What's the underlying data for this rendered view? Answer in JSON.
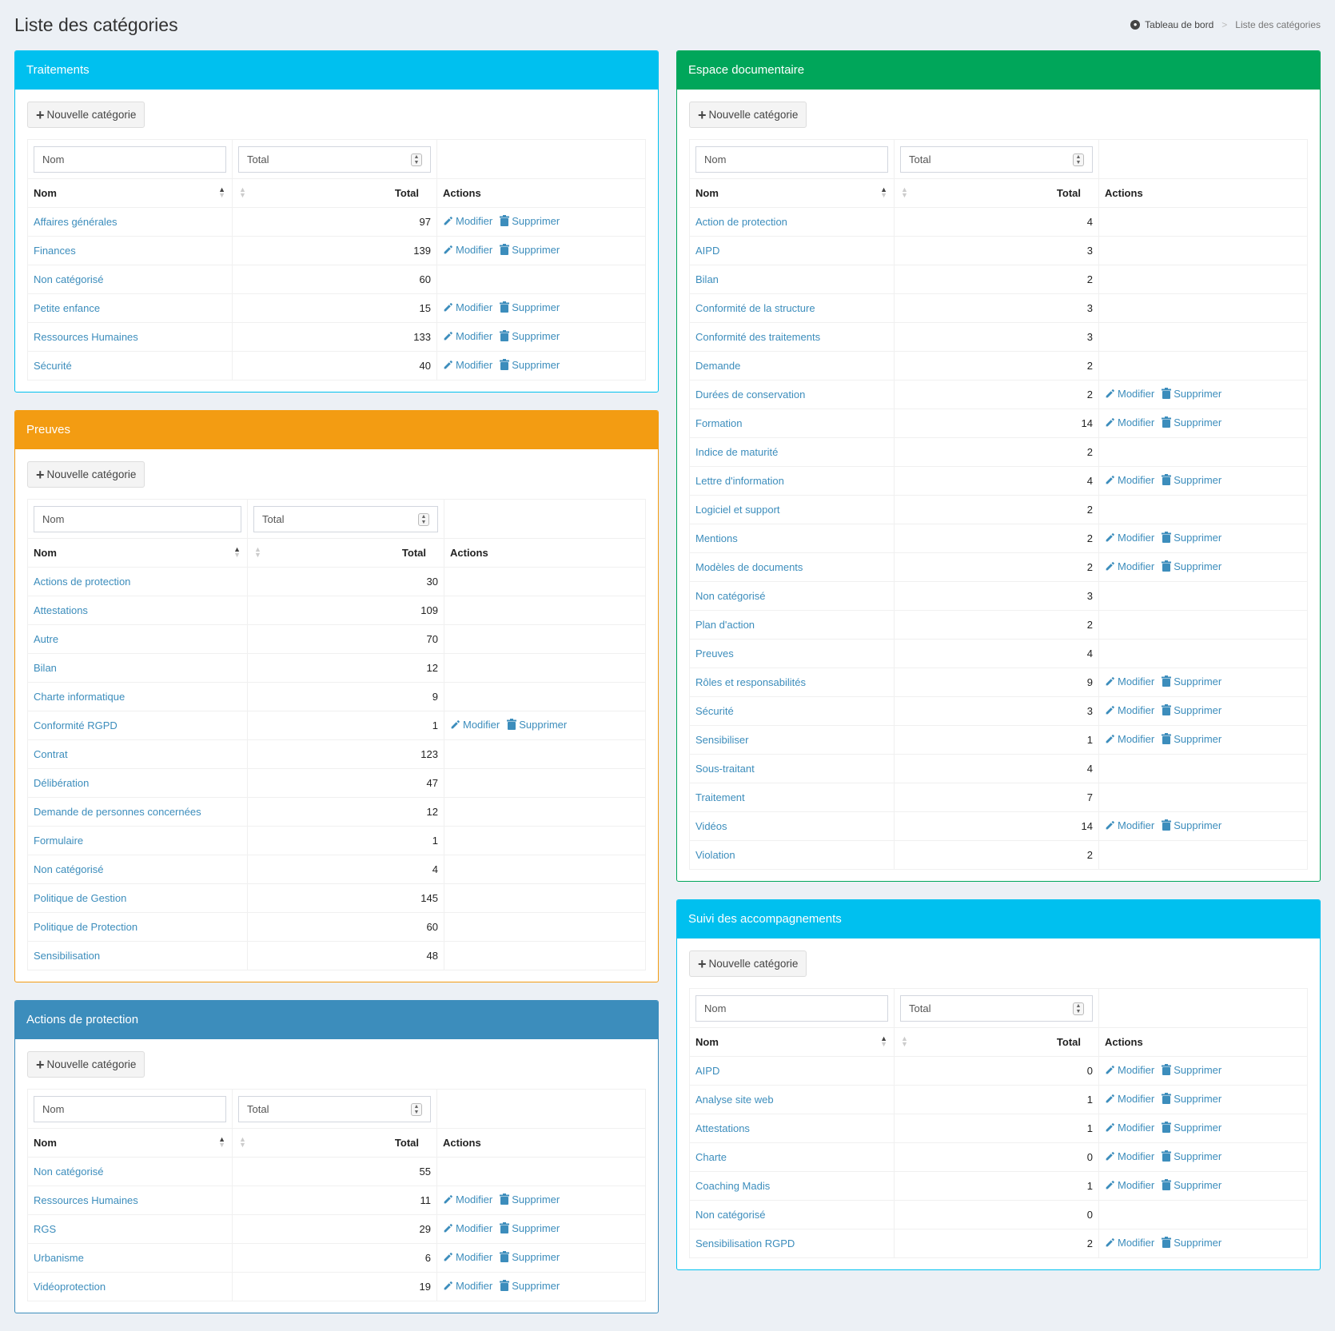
{
  "page": {
    "title": "Liste des catégories"
  },
  "breadcrumb": {
    "home": "Tableau de bord",
    "current": "Liste des catégories"
  },
  "labels": {
    "new_category": "Nouvelle catégorie",
    "filter_nom": "Nom",
    "filter_total": "Total",
    "col_nom": "Nom",
    "col_total": "Total",
    "col_actions": "Actions",
    "modifier": "Modifier",
    "supprimer": "Supprimer"
  },
  "colors": {
    "aqua": "#00c0ef",
    "green": "#00a65a",
    "orange": "#f39c12",
    "blue": "#3c8dbc",
    "link": "#3c8dbc"
  },
  "boxes": {
    "traitements": {
      "title": "Traitements",
      "rows": [
        {
          "nom": "Affaires générales",
          "total": "97",
          "actions": true
        },
        {
          "nom": "Finances",
          "total": "139",
          "actions": true
        },
        {
          "nom": "Non catégorisé",
          "total": "60",
          "actions": false
        },
        {
          "nom": "Petite enfance",
          "total": "15",
          "actions": true
        },
        {
          "nom": "Ressources Humaines",
          "total": "133",
          "actions": true
        },
        {
          "nom": "Sécurité",
          "total": "40",
          "actions": true
        }
      ]
    },
    "preuves": {
      "title": "Preuves",
      "rows": [
        {
          "nom": "Actions de protection",
          "total": "30",
          "actions": false
        },
        {
          "nom": "Attestations",
          "total": "109",
          "actions": false
        },
        {
          "nom": "Autre",
          "total": "70",
          "actions": false
        },
        {
          "nom": "Bilan",
          "total": "12",
          "actions": false
        },
        {
          "nom": "Charte informatique",
          "total": "9",
          "actions": false
        },
        {
          "nom": "Conformité RGPD",
          "total": "1",
          "actions": true
        },
        {
          "nom": "Contrat",
          "total": "123",
          "actions": false
        },
        {
          "nom": "Délibération",
          "total": "47",
          "actions": false
        },
        {
          "nom": "Demande de personnes concernées",
          "total": "12",
          "actions": false
        },
        {
          "nom": "Formulaire",
          "total": "1",
          "actions": false
        },
        {
          "nom": "Non catégorisé",
          "total": "4",
          "actions": false
        },
        {
          "nom": "Politique de Gestion",
          "total": "145",
          "actions": false
        },
        {
          "nom": "Politique de Protection",
          "total": "60",
          "actions": false
        },
        {
          "nom": "Sensibilisation",
          "total": "48",
          "actions": false
        }
      ]
    },
    "actions_protection": {
      "title": "Actions de protection",
      "rows": [
        {
          "nom": "Non catégorisé",
          "total": "55",
          "actions": false
        },
        {
          "nom": "Ressources Humaines",
          "total": "11",
          "actions": true
        },
        {
          "nom": "RGS",
          "total": "29",
          "actions": true
        },
        {
          "nom": "Urbanisme",
          "total": "6",
          "actions": true
        },
        {
          "nom": "Vidéoprotection",
          "total": "19",
          "actions": true
        }
      ]
    },
    "espace_documentaire": {
      "title": "Espace documentaire",
      "rows": [
        {
          "nom": "Action de protection",
          "total": "4",
          "actions": false
        },
        {
          "nom": "AIPD",
          "total": "3",
          "actions": false
        },
        {
          "nom": "Bilan",
          "total": "2",
          "actions": false
        },
        {
          "nom": "Conformité de la structure",
          "total": "3",
          "actions": false
        },
        {
          "nom": "Conformité des traitements",
          "total": "3",
          "actions": false
        },
        {
          "nom": "Demande",
          "total": "2",
          "actions": false
        },
        {
          "nom": "Durées de conservation",
          "total": "2",
          "actions": true
        },
        {
          "nom": "Formation",
          "total": "14",
          "actions": true
        },
        {
          "nom": "Indice de maturité",
          "total": "2",
          "actions": false
        },
        {
          "nom": "Lettre d'information",
          "total": "4",
          "actions": true
        },
        {
          "nom": "Logiciel et support",
          "total": "2",
          "actions": false
        },
        {
          "nom": "Mentions",
          "total": "2",
          "actions": true
        },
        {
          "nom": "Modèles de documents",
          "total": "2",
          "actions": true
        },
        {
          "nom": "Non catégorisé",
          "total": "3",
          "actions": false
        },
        {
          "nom": "Plan d'action",
          "total": "2",
          "actions": false
        },
        {
          "nom": "Preuves",
          "total": "4",
          "actions": false
        },
        {
          "nom": "Rôles et responsabilités",
          "total": "9",
          "actions": true
        },
        {
          "nom": "Sécurité",
          "total": "3",
          "actions": true
        },
        {
          "nom": "Sensibiliser",
          "total": "1",
          "actions": true
        },
        {
          "nom": "Sous-traitant",
          "total": "4",
          "actions": false
        },
        {
          "nom": "Traitement",
          "total": "7",
          "actions": false
        },
        {
          "nom": "Vidéos",
          "total": "14",
          "actions": true
        },
        {
          "nom": "Violation",
          "total": "2",
          "actions": false
        }
      ]
    },
    "suivi_accompagnements": {
      "title": "Suivi des accompagnements",
      "rows": [
        {
          "nom": "AIPD",
          "total": "0",
          "actions": true
        },
        {
          "nom": "Analyse site web",
          "total": "1",
          "actions": true
        },
        {
          "nom": "Attestations",
          "total": "1",
          "actions": true
        },
        {
          "nom": "Charte",
          "total": "0",
          "actions": true
        },
        {
          "nom": "Coaching Madis",
          "total": "1",
          "actions": true
        },
        {
          "nom": "Non catégorisé",
          "total": "0",
          "actions": false
        },
        {
          "nom": "Sensibilisation RGPD",
          "total": "2",
          "actions": true
        }
      ]
    }
  }
}
